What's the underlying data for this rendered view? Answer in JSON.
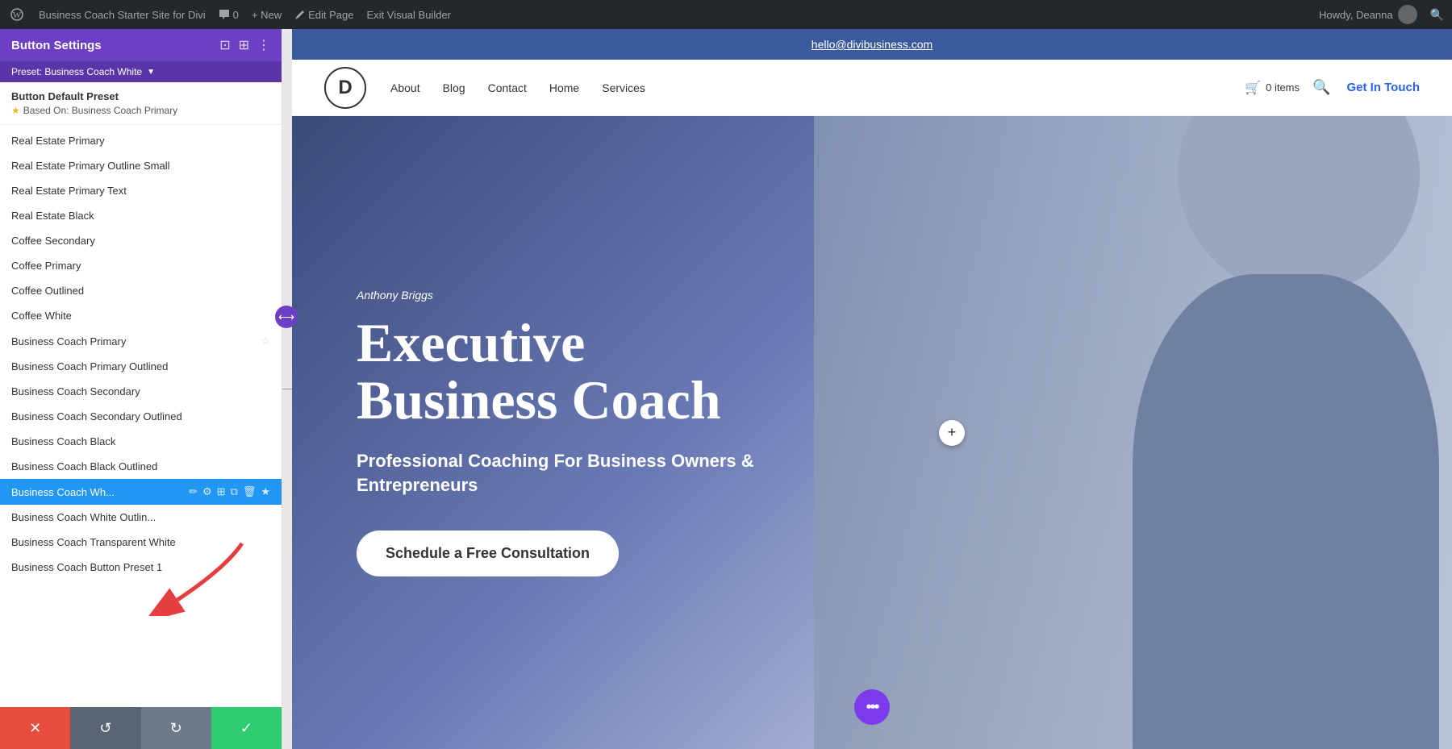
{
  "admin_bar": {
    "site_name": "Business Coach Starter Site for Divi",
    "comment_count": "0",
    "new_label": "+ New",
    "edit_page_label": "Edit Page",
    "exit_builder_label": "Exit Visual Builder",
    "howdy_label": "Howdy, Deanna"
  },
  "left_panel": {
    "title": "Button Settings",
    "preset_label": "Preset: Business Coach White",
    "default_preset_label": "Button Default Preset",
    "based_on_label": "Based On: Business Coach Primary",
    "presets": [
      {
        "id": 1,
        "label": "Real Estate Primary",
        "active": false
      },
      {
        "id": 2,
        "label": "Real Estate Primary Outline Small",
        "active": false
      },
      {
        "id": 3,
        "label": "Real Estate Primary Text",
        "active": false
      },
      {
        "id": 4,
        "label": "Real Estate Black",
        "active": false
      },
      {
        "id": 5,
        "label": "Coffee Secondary",
        "active": false
      },
      {
        "id": 6,
        "label": "Coffee Primary",
        "active": false
      },
      {
        "id": 7,
        "label": "Coffee Outlined",
        "active": false
      },
      {
        "id": 8,
        "label": "Coffee White",
        "active": false
      },
      {
        "id": 9,
        "label": "Business Coach Primary",
        "active": false,
        "star": true
      },
      {
        "id": 10,
        "label": "Business Coach Primary Outlined",
        "active": false
      },
      {
        "id": 11,
        "label": "Business Coach Secondary",
        "active": false
      },
      {
        "id": 12,
        "label": "Business Coach Secondary Outlined",
        "active": false
      },
      {
        "id": 13,
        "label": "Business Coach Black",
        "active": false
      },
      {
        "id": 14,
        "label": "Business Coach Black Outlined",
        "active": false
      },
      {
        "id": 15,
        "label": "Business Coach Wh...",
        "active": true
      },
      {
        "id": 16,
        "label": "Business Coach White Outlin...",
        "active": false
      },
      {
        "id": 17,
        "label": "Business Coach Transparent White",
        "active": false
      },
      {
        "id": 18,
        "label": "Business Coach Button Preset 1",
        "active": false
      }
    ],
    "bottom_buttons": {
      "close": "✕",
      "undo": "↺",
      "redo": "↻",
      "save": "✓"
    }
  },
  "site": {
    "topbar_email": "hello@divibusiness.com",
    "logo_letter": "D",
    "nav_links": [
      "About",
      "Blog",
      "Contact",
      "Home",
      "Services"
    ],
    "cart_text": "0 items",
    "get_in_touch": "Get In Touch",
    "hero": {
      "author": "Anthony Briggs",
      "title": "Executive Business Coach",
      "subtitle": "Professional Coaching For Business Owners & Entrepreneurs",
      "cta_label": "Schedule a Free Consultation"
    }
  }
}
